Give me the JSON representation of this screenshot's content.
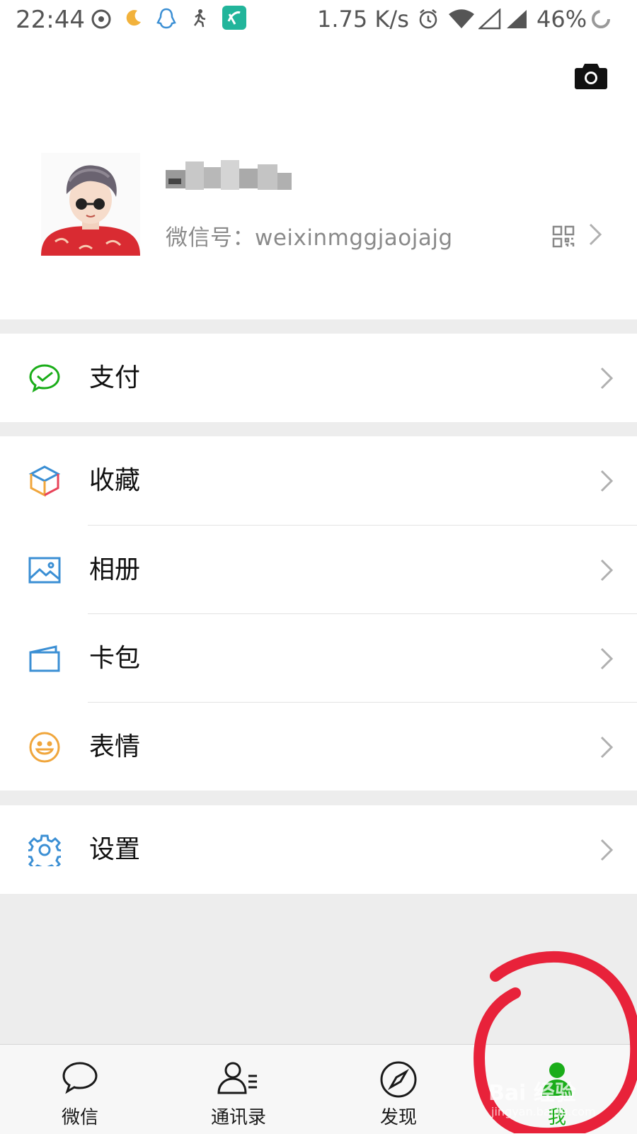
{
  "status_bar": {
    "time": "22:44",
    "network_speed": "1.75 K/s",
    "battery": "46%",
    "icons": [
      "netease-music-icon",
      "moon-icon",
      "qq-icon",
      "runner-icon",
      "app-icon",
      "alarm-icon",
      "wifi-icon",
      "signal-icon",
      "signal-icon",
      "loading-icon"
    ]
  },
  "profile": {
    "wechat_id": "微信号：weixinmggjaojajg",
    "icons": [
      "camera-icon",
      "qr-code-icon",
      "chevron-right-icon"
    ]
  },
  "menu": {
    "pay": {
      "label": "支付",
      "icon": "wechat-pay-icon",
      "color": "#1aad19"
    },
    "favorites": {
      "label": "收藏",
      "icon": "favorites-cube-icon"
    },
    "album": {
      "label": "相册",
      "icon": "photo-icon",
      "color": "#3b8fd4"
    },
    "cards": {
      "label": "卡包",
      "icon": "card-wallet-icon",
      "color": "#3b8fd4"
    },
    "stickers": {
      "label": "表情",
      "icon": "smile-icon",
      "color": "#f0a63c"
    },
    "settings": {
      "label": "设置",
      "icon": "gear-icon",
      "color": "#3b8fd4"
    }
  },
  "tabbar": {
    "tabs": [
      {
        "label": "微信",
        "icon": "chat-bubble-icon"
      },
      {
        "label": "通讯录",
        "icon": "contacts-icon"
      },
      {
        "label": "发现",
        "icon": "compass-icon"
      },
      {
        "label": "我",
        "icon": "person-icon",
        "active": true
      }
    ]
  },
  "watermark": {
    "text": "Bai 经验",
    "subtext": "jingyan.baidu.com"
  },
  "colors": {
    "accent": "#1aad19",
    "background": "#ededed",
    "annotation": "#e8223a"
  }
}
